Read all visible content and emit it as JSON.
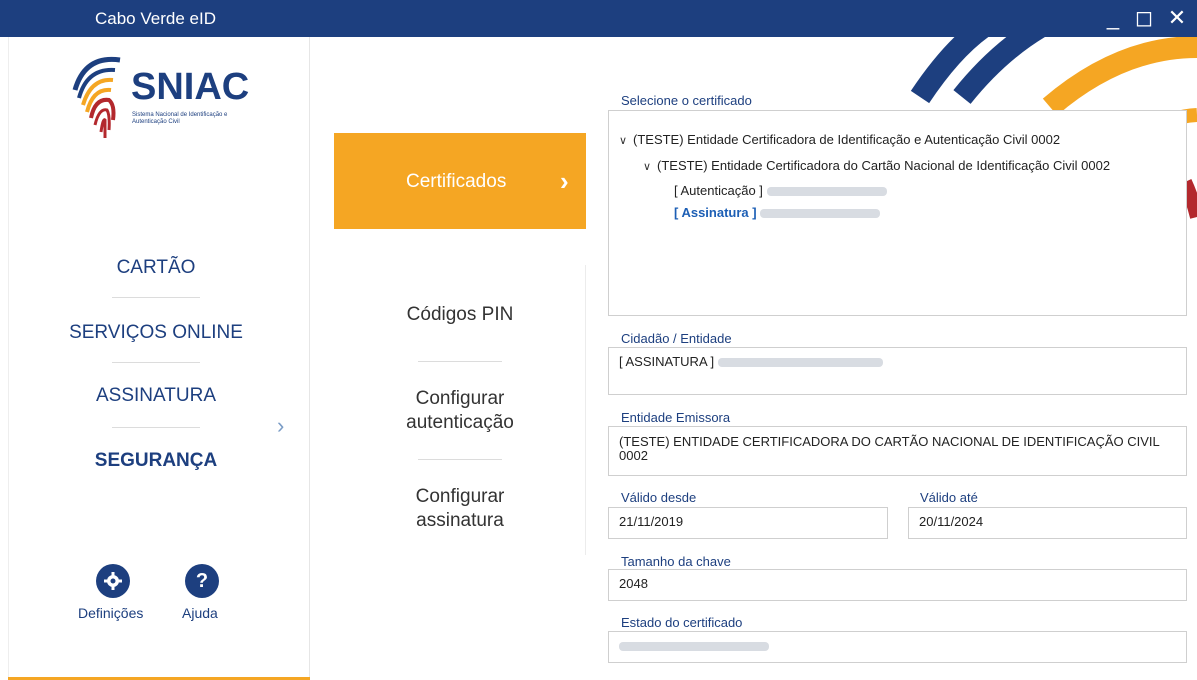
{
  "window": {
    "title": "Cabo Verde eID",
    "minimize": "_",
    "maximize": "◻",
    "close": "✕"
  },
  "logo": {
    "name": "SNIAC",
    "subtitle": "Sistema Nacional de Identificação e Autenticação Civil"
  },
  "sidebar": {
    "items": [
      {
        "label": "CARTÃO"
      },
      {
        "label": "SERVIÇOS ONLINE"
      },
      {
        "label": "ASSINATURA"
      },
      {
        "label": "SEGURANÇA"
      }
    ],
    "footer": {
      "settings_label": "Definições",
      "help_label": "Ajuda"
    }
  },
  "submenu": {
    "active": "Certificados",
    "items": [
      {
        "label": "Códigos PIN"
      },
      {
        "label": "Configurar autenticação"
      },
      {
        "label": "Configurar assinatura"
      }
    ]
  },
  "certificates": {
    "select_label": "Selecione o certificado",
    "tree": {
      "root": "(TESTE) Entidade Certificadora de Identificação e Autenticação Civil 0002",
      "child": "(TESTE) Entidade Certificadora do Cartão Nacional de Identificação Civil 0002",
      "leaf_auth": "[ Autenticação ]",
      "leaf_sign": "[ Assinatura ]"
    }
  },
  "details": {
    "citizen_label": "Cidadão / Entidade",
    "citizen_value": "[ ASSINATURA ]",
    "issuer_label": "Entidade Emissora",
    "issuer_value": "(TESTE) ENTIDADE CERTIFICADORA DO CARTÃO NACIONAL DE IDENTIFICAÇÃO CIVIL 0002",
    "valid_from_label": "Válido desde",
    "valid_from": "21/11/2019",
    "valid_to_label": "Válido até",
    "valid_to": "20/11/2024",
    "key_size_label": "Tamanho da chave",
    "key_size": "2048",
    "status_label": "Estado do certificado"
  },
  "colors": {
    "navy": "#1d3f7f",
    "orange": "#f5a623",
    "red": "#b3282d",
    "link": "#1d5fb5"
  }
}
